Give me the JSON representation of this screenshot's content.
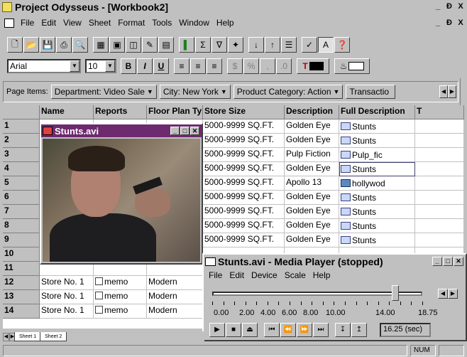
{
  "app": {
    "title": "Project Odysseus - [Workbook2]",
    "window_buttons": [
      "_",
      "Ɖ",
      "X"
    ],
    "doc_buttons": [
      "_",
      "Ɖ",
      "X"
    ]
  },
  "menu": [
    "File",
    "Edit",
    "View",
    "Sheet",
    "Format",
    "Tools",
    "Window",
    "Help"
  ],
  "toolbar2": {
    "font": "Arial",
    "size": "10",
    "bold": "B",
    "italic": "I",
    "underline": "U"
  },
  "page_items": {
    "label": "Page Items:",
    "filters": [
      "Department: Video Sale",
      "City: New York",
      "Product Category: Action",
      "Transactio"
    ]
  },
  "grid": {
    "headers": [
      "Name",
      "Reports",
      "Floor Plan Type",
      "Store Size",
      "Description",
      "Full Description",
      "T"
    ],
    "rows": [
      {
        "num": "1",
        "name": "",
        "reports": "",
        "floor": "",
        "size": "5000-9999 SQ.FT.",
        "desc": "Golden Eye",
        "full": "Stunts"
      },
      {
        "num": "2",
        "name": "",
        "reports": "",
        "floor": "",
        "size": "5000-9999 SQ.FT.",
        "desc": "Golden Eye",
        "full": "Stunts"
      },
      {
        "num": "3",
        "name": "",
        "reports": "",
        "floor": "",
        "size": "5000-9999 SQ.FT.",
        "desc": "Pulp Fiction",
        "full": "Pulp_fic"
      },
      {
        "num": "4",
        "name": "",
        "reports": "",
        "floor": "",
        "size": "5000-9999 SQ.FT.",
        "desc": "Golden Eye",
        "full": "Stunts"
      },
      {
        "num": "5",
        "name": "",
        "reports": "",
        "floor": "",
        "size": "5000-9999 SQ.FT.",
        "desc": "Apollo 13",
        "full": "hollywod"
      },
      {
        "num": "6",
        "name": "",
        "reports": "",
        "floor": "",
        "size": "5000-9999 SQ.FT.",
        "desc": "Golden Eye",
        "full": "Stunts"
      },
      {
        "num": "7",
        "name": "",
        "reports": "",
        "floor": "",
        "size": "5000-9999 SQ.FT.",
        "desc": "Golden Eye",
        "full": "Stunts"
      },
      {
        "num": "8",
        "name": "",
        "reports": "",
        "floor": "",
        "size": "5000-9999 SQ.FT.",
        "desc": "Golden Eye",
        "full": "Stunts"
      },
      {
        "num": "9",
        "name": "",
        "reports": "",
        "floor": "",
        "size": "5000-9999 SQ.FT.",
        "desc": "Golden Eye",
        "full": "Stunts"
      },
      {
        "num": "10",
        "name": "",
        "reports": "",
        "floor": "",
        "size": "",
        "desc": "",
        "full": ""
      },
      {
        "num": "11",
        "name": "",
        "reports": "",
        "floor": "",
        "size": "",
        "desc": "",
        "full": ""
      },
      {
        "num": "12",
        "name": "Store No. 1",
        "reports": "memo",
        "floor": "Modern",
        "size": "",
        "desc": "",
        "full": ""
      },
      {
        "num": "13",
        "name": "Store No. 1",
        "reports": "memo",
        "floor": "Modern",
        "size": "",
        "desc": "",
        "full": ""
      },
      {
        "num": "14",
        "name": "Store No. 1",
        "reports": "memo",
        "floor": "Modern",
        "size": "",
        "desc": "",
        "full": ""
      }
    ]
  },
  "video_window": {
    "title": "Stunts.avi"
  },
  "media_player": {
    "title": "Stunts.avi - Media Player (stopped)",
    "menu": [
      "File",
      "Edit",
      "Device",
      "Scale",
      "Help"
    ],
    "scale_labels": [
      "0.00",
      "2.00",
      "4.00",
      "6.00",
      "8.00",
      "10.00",
      "14.00",
      "18.75"
    ],
    "position_fraction": 0.87,
    "position": "16.25 (sec)"
  },
  "sheet_tabs": [
    "Sheet 1",
    "Sheet 2"
  ],
  "status": {
    "num": "NUM"
  }
}
